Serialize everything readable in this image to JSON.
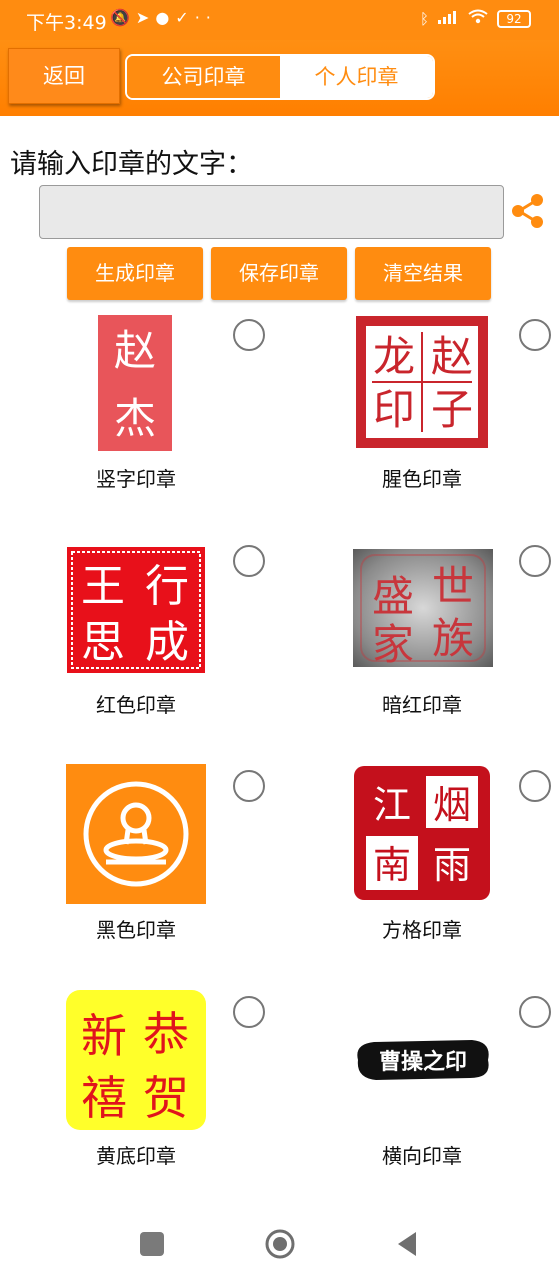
{
  "status": {
    "time": "下午3:49",
    "icons": [
      "mute-icon",
      "telegram-icon",
      "chat-icon",
      "check-icon",
      "more-icon"
    ],
    "battery": "92"
  },
  "toolbar": {
    "back_label": "返回",
    "tabs": [
      {
        "label": "公司印章",
        "active": false
      },
      {
        "label": "个人印章",
        "active": true
      }
    ]
  },
  "form": {
    "prompt": "请输入印章的文字：",
    "input_value": "",
    "share_icon": "share-icon"
  },
  "actions": {
    "generate": "生成印章",
    "save": "保存印章",
    "clear": "清空结果"
  },
  "stamps": [
    {
      "label": "竖字印章",
      "chars": [
        "赵",
        "杰"
      ],
      "selected": false
    },
    {
      "label": "腥色印章",
      "chars": [
        "龙",
        "赵",
        "印",
        "子"
      ],
      "selected": false
    },
    {
      "label": "红色印章",
      "chars": [
        "行",
        "王",
        "成",
        "思"
      ],
      "selected": false
    },
    {
      "label": "暗红印章",
      "chars": [
        "世",
        "盛",
        "族",
        "家"
      ],
      "selected": false
    },
    {
      "label": "黑色印章",
      "chars": [],
      "selected": false
    },
    {
      "label": "方格印章",
      "chars": [
        "烟",
        "江",
        "雨",
        "南"
      ],
      "selected": false
    },
    {
      "label": "黄底印章",
      "chars": [
        "恭",
        "新",
        "贺",
        "禧"
      ],
      "selected": false
    },
    {
      "label": "横向印章",
      "chars": [
        "曹操之印"
      ],
      "selected": false
    }
  ],
  "colors": {
    "accent": "#ff8c10",
    "seal_red": "#d3272e",
    "bright_red": "#e8101a",
    "dark_red_bg": "#5a5a5a",
    "yellow_bg": "#ffff2a"
  },
  "navbar": {
    "icons": [
      "recent-apps-icon",
      "home-icon",
      "back-icon"
    ]
  }
}
